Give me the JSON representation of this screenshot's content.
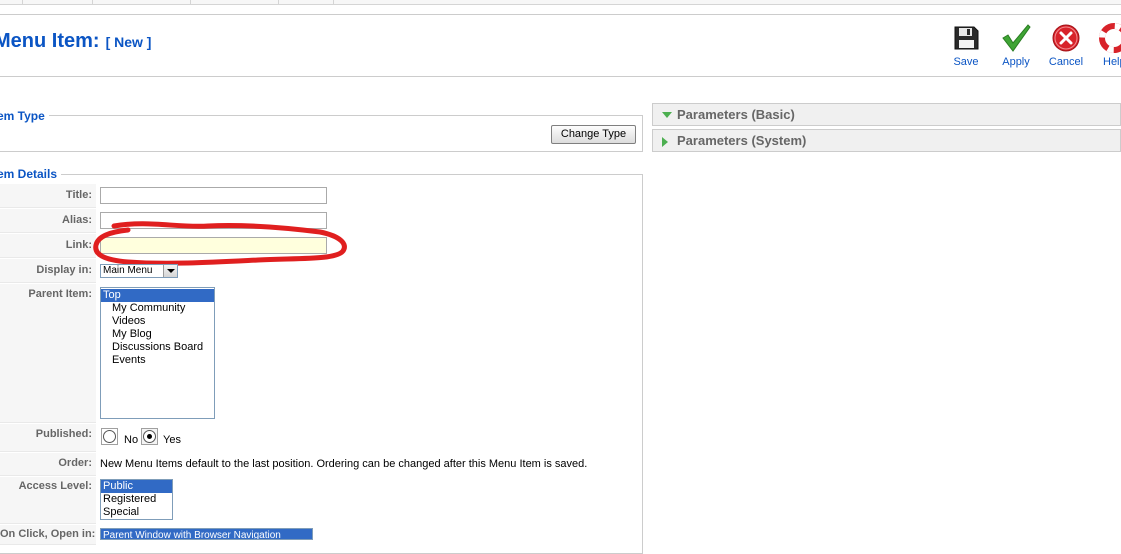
{
  "header": {
    "title": "Menu Item:",
    "title_suffix": "[ New ]"
  },
  "toolbar": {
    "save_label": "Save",
    "apply_label": "Apply",
    "cancel_label": "Cancel",
    "help_label": "Help"
  },
  "menu_type": {
    "legend": "Menu Item Type",
    "change_button": "Change Type"
  },
  "details": {
    "legend": "Menu Item Details",
    "title_label": "Title:",
    "title_value": "",
    "alias_label": "Alias:",
    "alias_value": "",
    "link_label": "Link:",
    "link_value": "",
    "display_in_label": "Display in:",
    "display_in_value": "Main Menu",
    "parent_label": "Parent Item:",
    "parent_items": [
      "Top",
      "My Community",
      "Videos",
      "My Blog",
      "Discussions Board",
      "Events"
    ],
    "parent_selected": "Top",
    "published_label": "Published:",
    "published_no": "No",
    "published_yes": "Yes",
    "published_value": "Yes",
    "order_label": "Order:",
    "order_text": "New Menu Items default to the last position. Ordering can be changed after this Menu Item is saved.",
    "access_label": "Access Level:",
    "access_levels": [
      "Public",
      "Registered",
      "Special"
    ],
    "access_selected": "Public",
    "onclick_label": "On Click, Open in:",
    "onclick_value": "Parent Window with Browser Navigation"
  },
  "params": {
    "basic": "Parameters (Basic)",
    "system": "Parameters (System)"
  },
  "colors": {
    "title_blue": "#0b55c4",
    "selection_blue": "#316ac5",
    "annotation_red": "#e01f1f",
    "link_field_bg": "#ffffdd"
  },
  "icons": {
    "save": "floppy-disk-icon",
    "apply": "check-icon",
    "cancel": "cancel-icon",
    "help": "help-lifebuoy-icon"
  }
}
